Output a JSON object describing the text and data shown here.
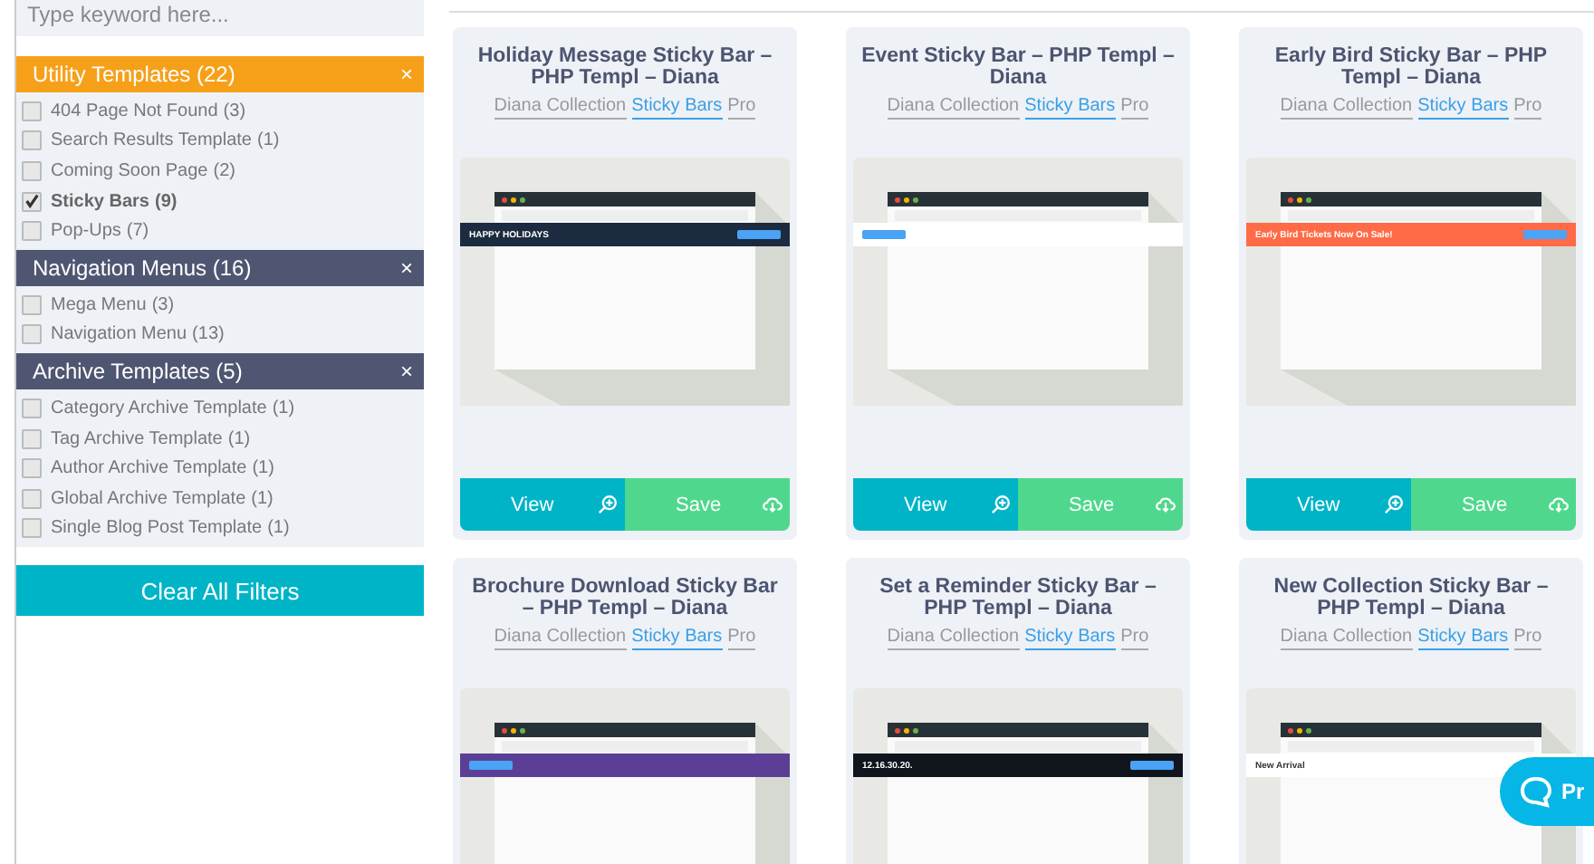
{
  "search": {
    "placeholder": "Type keyword here..."
  },
  "filter_groups": [
    {
      "title": "Utility Templates (22)",
      "color": "#f6a01a",
      "close": "×",
      "items": [
        {
          "label": "404 Page Not Found",
          "count": "(3)",
          "checked": false
        },
        {
          "label": "Search Results Template",
          "count": "(1)",
          "checked": false
        },
        {
          "label": "Coming Soon Page",
          "count": "(2)",
          "checked": false
        },
        {
          "label": "Sticky Bars",
          "count": "(9)",
          "checked": true
        },
        {
          "label": "Pop-Ups",
          "count": "(7)",
          "checked": false
        }
      ]
    },
    {
      "title": "Navigation Menus (16)",
      "color": "#4f5672",
      "close": "×",
      "items": [
        {
          "label": "Mega Menu",
          "count": "(3)",
          "checked": false
        },
        {
          "label": "Navigation Menu",
          "count": "(13)",
          "checked": false
        }
      ]
    },
    {
      "title": "Archive Templates (5)",
      "color": "#4f5672",
      "close": "×",
      "items": [
        {
          "label": "Category Archive Template",
          "count": "(1)",
          "checked": false
        },
        {
          "label": "Tag Archive Template",
          "count": "(1)",
          "checked": false
        },
        {
          "label": "Author Archive Template",
          "count": "(1)",
          "checked": false
        },
        {
          "label": "Global Archive Template",
          "count": "(1)",
          "checked": false
        },
        {
          "label": "Single Blog Post Template",
          "count": "(1)",
          "checked": false
        }
      ]
    }
  ],
  "clear_button": "Clear All Filters",
  "cards": [
    {
      "title": "Holiday Message Sticky Bar – PHP Templ – Diana",
      "links": [
        "Diana Collection",
        "Sticky Bars",
        "Pro"
      ],
      "preview": {
        "color": "#1c2b40",
        "text": "HAPPY HOLIDAYS"
      },
      "view": "View",
      "save": "Save"
    },
    {
      "title": "Event Sticky Bar – PHP Templ – Diana",
      "links": [
        "Diana Collection",
        "Sticky Bars",
        "Pro"
      ],
      "preview": {
        "color": "#ffffff"
      },
      "view": "View",
      "save": "Save"
    },
    {
      "title": "Early Bird Sticky Bar – PHP Templ – Diana",
      "links": [
        "Diana Collection",
        "Sticky Bars",
        "Pro"
      ],
      "preview": {
        "color": "#ff6b47",
        "text": "Early Bird Tickets Now On Sale!"
      },
      "view": "View",
      "save": "Save"
    },
    {
      "title": "Brochure Download Sticky Bar – PHP Templ – Diana",
      "links": [
        "Diana Collection",
        "Sticky Bars",
        "Pro"
      ],
      "preview": {
        "color": "#5b3f96"
      }
    },
    {
      "title": "Set a Reminder Sticky Bar – PHP Templ – Diana",
      "links": [
        "Diana Collection",
        "Sticky Bars",
        "Pro"
      ],
      "preview": {
        "color": "#10141c",
        "text": "12.16.30.20."
      }
    },
    {
      "title": "New Collection Sticky Bar – PHP Templ – Diana",
      "links": [
        "Diana Collection",
        "Sticky Bars",
        "Pro"
      ],
      "preview": {
        "color": "#ffffff",
        "text": "New Arrival"
      }
    }
  ],
  "chat_button": {
    "label": "Pr"
  }
}
